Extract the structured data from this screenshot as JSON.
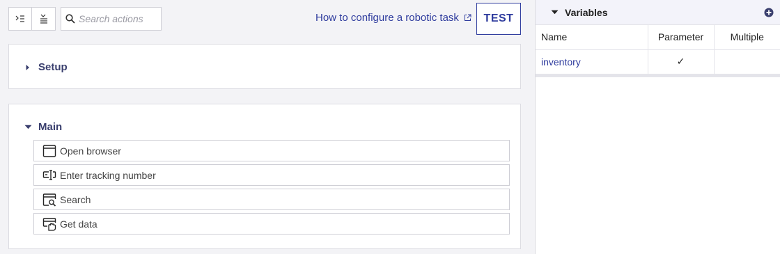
{
  "toolbar": {
    "expand_all_icon": "expand-all-icon",
    "collapse_all_icon": "collapse-all-icon",
    "search_placeholder": "Search actions",
    "search_value": ""
  },
  "help_link": {
    "label": "How to configure a robotic task",
    "icon": "external-link-icon"
  },
  "test_button": {
    "label": "TEST"
  },
  "sections": {
    "setup": {
      "title": "Setup",
      "expanded": false
    },
    "main": {
      "title": "Main",
      "expanded": true,
      "actions": [
        {
          "label": "Open browser",
          "icon": "browser-window-icon"
        },
        {
          "label": "Enter tracking number",
          "icon": "keyboard-input-icon"
        },
        {
          "label": "Search",
          "icon": "search-window-icon"
        },
        {
          "label": "Get data",
          "icon": "get-data-icon"
        }
      ]
    }
  },
  "variables": {
    "title": "Variables",
    "add_icon": "plus-circle-icon",
    "columns": [
      "Name",
      "Parameter",
      "Multiple"
    ],
    "rows": [
      {
        "name": "inventory",
        "parameter": "✓",
        "multiple": ""
      }
    ]
  },
  "colors": {
    "accent": "#2f3c9e",
    "section_title": "#3a3f6e",
    "panel_bg": "#f3f3f6"
  }
}
